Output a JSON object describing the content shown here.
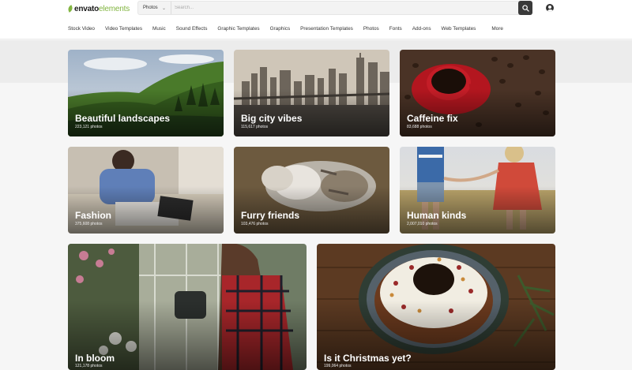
{
  "brand": {
    "name_part1": "envato",
    "name_part2": "elements"
  },
  "search": {
    "category": "Photos",
    "placeholder": "Search..."
  },
  "nav": [
    "Stock Video",
    "Video Templates",
    "Music",
    "Sound Effects",
    "Graphic Templates",
    "Graphics",
    "Presentation Templates",
    "Photos",
    "Fonts",
    "Add-ons",
    "Web Templates",
    "More"
  ],
  "collections": [
    {
      "title": "Beautiful landscapes",
      "count": "223,121 photos"
    },
    {
      "title": "Big city vibes",
      "count": "115,617 photos"
    },
    {
      "title": "Caffeine fix",
      "count": "83,688 photos"
    },
    {
      "title": "Fashion",
      "count": "375,608 photos"
    },
    {
      "title": "Furry friends",
      "count": "103,476 photos"
    },
    {
      "title": "Human kinds",
      "count": "2,007,010 photos"
    },
    {
      "title": "In bloom",
      "count": "121,178 photos"
    },
    {
      "title": "Is it Christmas yet?",
      "count": "199,064 photos"
    }
  ]
}
